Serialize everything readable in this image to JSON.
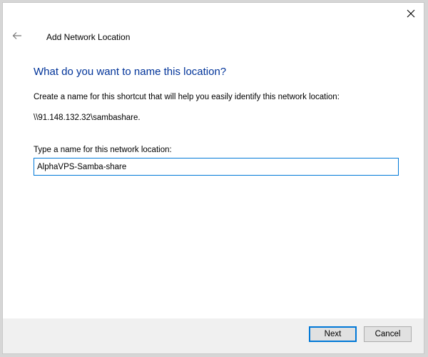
{
  "window": {
    "title": "Add Network Location"
  },
  "icons": {
    "back": "back-arrow-icon",
    "close": "close-icon"
  },
  "main": {
    "heading": "What do you want to name this location?",
    "description": "Create a name for this shortcut that will help you easily identify this network location:",
    "network_path": "\\\\91.148.132.32\\sambashare.",
    "field_label": "Type a name for this network location:",
    "name_value": "AlphaVPS-Samba-share"
  },
  "footer": {
    "next_label": "Next",
    "cancel_label": "Cancel"
  },
  "colors": {
    "heading": "#003399",
    "accent": "#0078d7",
    "footer_bg": "#f0f0f0"
  }
}
